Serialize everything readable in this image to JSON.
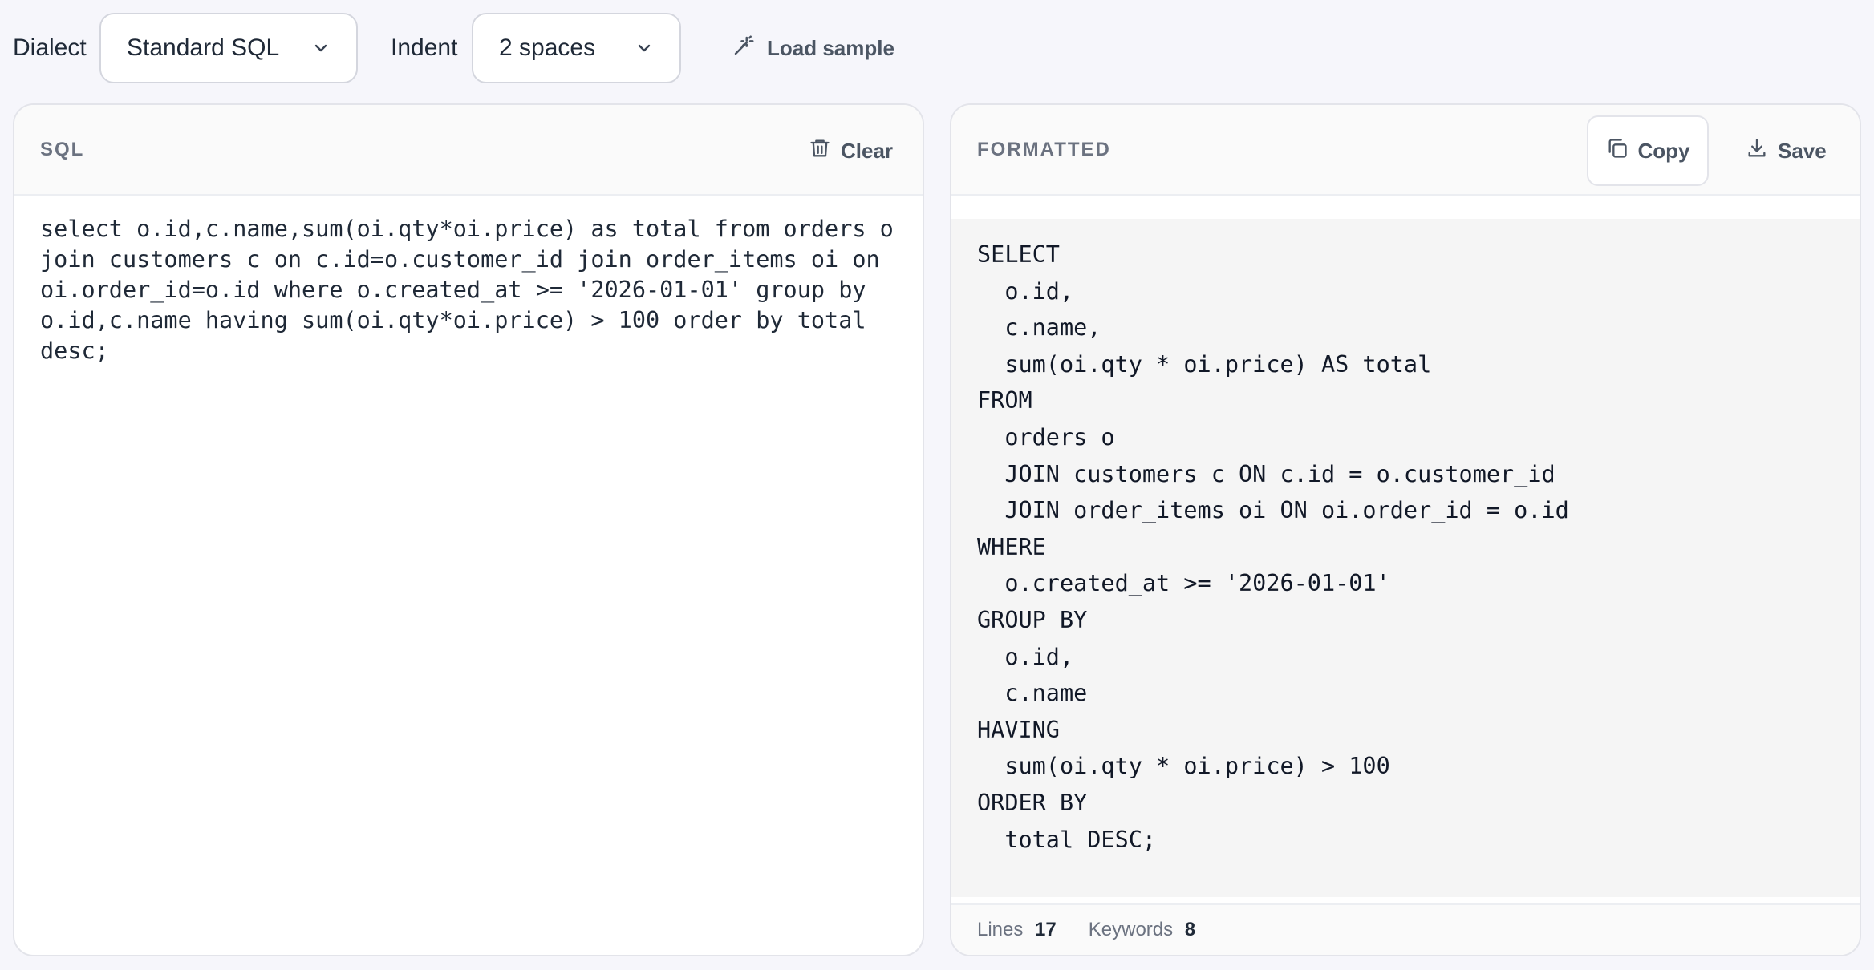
{
  "toolbar": {
    "dialect_label": "Dialect",
    "dialect_value": "Standard SQL",
    "indent_label": "Indent",
    "indent_value": "2 spaces",
    "load_sample_label": "Load sample",
    "icons": {
      "chevron": "chevron-down-icon",
      "load_sample": "magic-wand-icon"
    }
  },
  "input_panel": {
    "title": "SQL",
    "clear_label": "Clear",
    "clear_icon": "trash-icon",
    "sql": "select o.id,c.name,sum(oi.qty*oi.price) as total from orders o join customers c on c.id=o.customer_id join order_items oi on oi.order_id=o.id where o.created_at >= '2026-01-01' group by o.id,c.name having sum(oi.qty*oi.price) > 100 order by total desc;"
  },
  "output_panel": {
    "title": "FORMATTED",
    "copy_label": "Copy",
    "copy_icon": "copy-icon",
    "save_label": "Save",
    "save_icon": "download-icon",
    "formatted": "SELECT\n  o.id,\n  c.name,\n  sum(oi.qty * oi.price) AS total\nFROM\n  orders o\n  JOIN customers c ON c.id = o.customer_id\n  JOIN order_items oi ON oi.order_id = o.id\nWHERE\n  o.created_at >= '2026-01-01'\nGROUP BY\n  o.id,\n  c.name\nHAVING\n  sum(oi.qty * oi.price) > 100\nORDER BY\n  total DESC;",
    "stats": {
      "lines_label": "Lines",
      "lines_value": "17",
      "keywords_label": "Keywords",
      "keywords_value": "8"
    }
  },
  "colors": {
    "background": "#f6f6fb",
    "panel_border": "#e3e4ea",
    "code_background": "#f5f5f5",
    "muted_text": "#6b7280"
  }
}
